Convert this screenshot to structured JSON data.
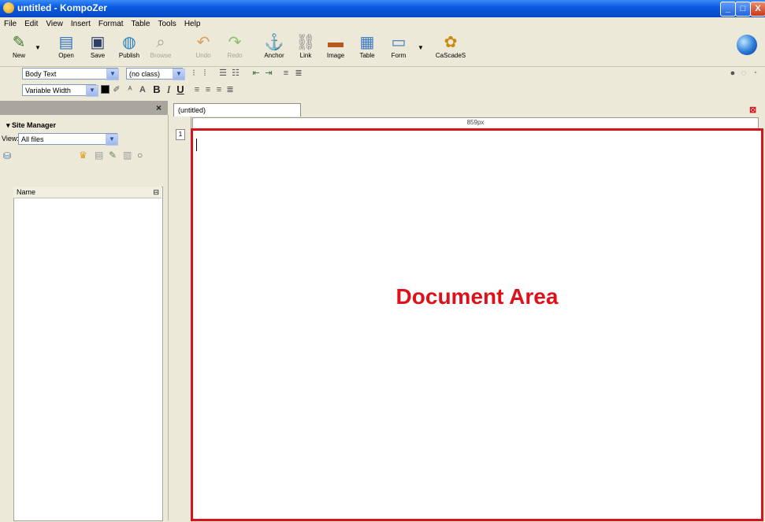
{
  "window": {
    "title": "untitled - KompoZer",
    "minimize": "_",
    "maximize": "□",
    "close": "X"
  },
  "menu": [
    "File",
    "Edit",
    "View",
    "Insert",
    "Format",
    "Table",
    "Tools",
    "Help"
  ],
  "toolbar": {
    "new": "New",
    "open": "Open",
    "save": "Save",
    "publish": "Publish",
    "browse": "Browse",
    "undo": "Undo",
    "redo": "Redo",
    "anchor": "Anchor",
    "link": "Link",
    "image": "Image",
    "table": "Table",
    "form": "Form",
    "cascades": "CaScadeS"
  },
  "format1": {
    "paragraph": "Body Text",
    "class": "(no class)"
  },
  "format2": {
    "font": "Variable Width",
    "bold": "B",
    "italic": "I",
    "underline": "U"
  },
  "sidebar": {
    "close": "×",
    "title": "Site Manager",
    "view_label": "View:",
    "view_value": "All files",
    "column": "Name"
  },
  "document": {
    "tab": "(untitled)",
    "ruler": "859px",
    "label": "Document Area",
    "line_number": "1"
  }
}
